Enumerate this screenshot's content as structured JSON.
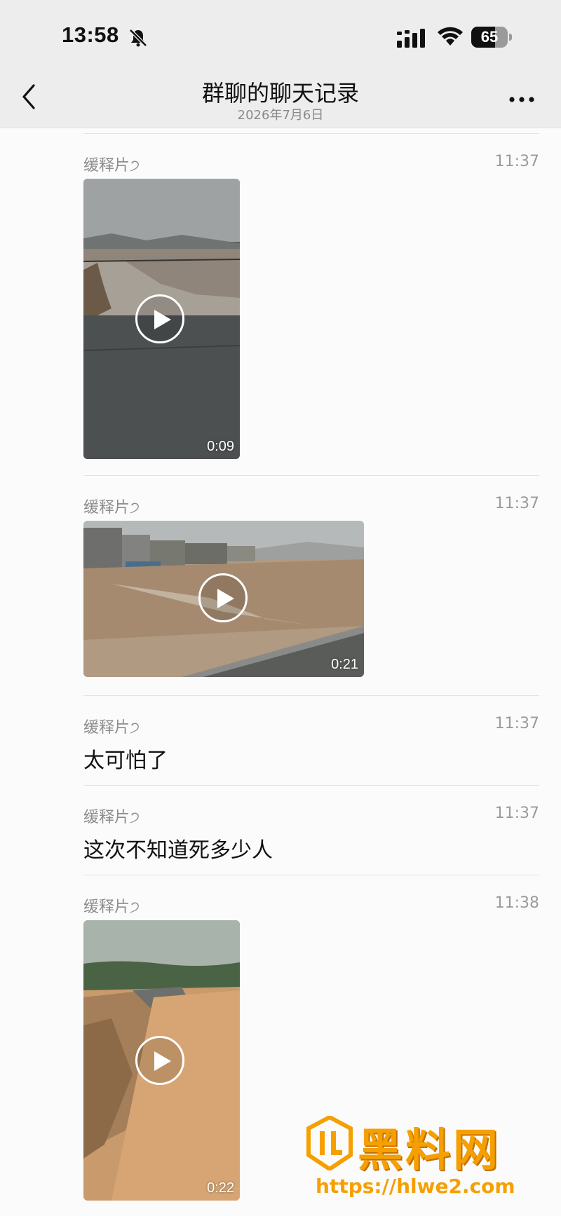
{
  "status_bar": {
    "time": "13:58",
    "battery": "65",
    "battery_level": 0.65,
    "icons": [
      "bell-muted-icon",
      "signal-icon",
      "wifi-icon",
      "battery-icon"
    ]
  },
  "nav": {
    "title": "群聊的聊天记录",
    "subtitle": "2026年7月6日",
    "icons": [
      "back-chevron-icon",
      "more-icon"
    ]
  },
  "messages": [
    {
      "sender": "缓释片੭",
      "time": "11:37",
      "type": "video",
      "duration": "0:09"
    },
    {
      "sender": "缓释片੭",
      "time": "11:37",
      "type": "video",
      "duration": "0:21"
    },
    {
      "sender": "缓释片੭",
      "time": "11:37",
      "type": "text",
      "text": "太可怕了"
    },
    {
      "sender": "缓释片੭",
      "time": "11:37",
      "type": "text",
      "text": "这次不知道死多少人"
    },
    {
      "sender": "缓释片੭",
      "time": "11:38",
      "type": "video",
      "duration": "0:22"
    }
  ],
  "watermark": {
    "text": "黑料网",
    "url": "https://hlwe2.com",
    "color": "#f5a000"
  }
}
